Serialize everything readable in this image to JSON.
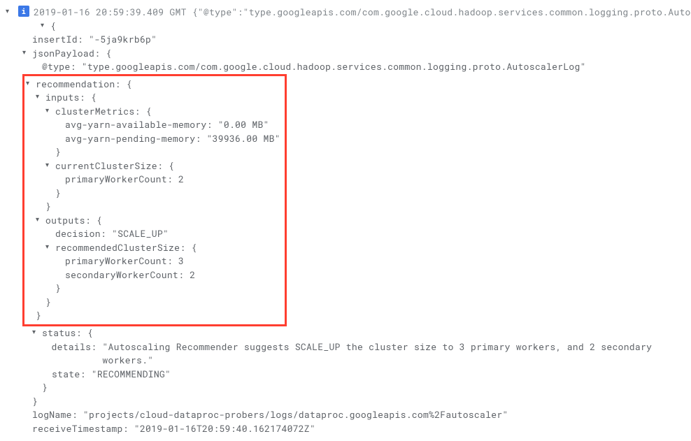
{
  "header": {
    "timestamp": "2019-01-16 20:59:39.409 GMT",
    "summary": "{\"@type\":\"type.googleapis.com/com.google.cloud.hadoop.services.common.logging.proto.AutoscalerLog\""
  },
  "root": {
    "open": "{",
    "insertId": {
      "key": "insertId:",
      "value": "\"-5ja9krb6p\""
    },
    "jsonPayload": {
      "key": "jsonPayload:",
      "open": "{",
      "atType": {
        "key": "@type:",
        "value": "\"type.googleapis.com/com.google.cloud.hadoop.services.common.logging.proto.AutoscalerLog\""
      },
      "recommendation": {
        "key": "recommendation:",
        "open": "{",
        "inputs": {
          "key": "inputs:",
          "open": "{",
          "clusterMetrics": {
            "key": "clusterMetrics:",
            "open": "{",
            "avgAvail": {
              "key": "avg-yarn-available-memory:",
              "value": "\"0.00 MB\""
            },
            "avgPending": {
              "key": "avg-yarn-pending-memory:",
              "value": "\"39936.00 MB\""
            },
            "close": "}"
          },
          "currentClusterSize": {
            "key": "currentClusterSize:",
            "open": "{",
            "primaryWorkerCount": {
              "key": "primaryWorkerCount:",
              "value": "2"
            },
            "close": "}"
          },
          "close": "}"
        },
        "outputs": {
          "key": "outputs:",
          "open": "{",
          "decision": {
            "key": "decision:",
            "value": "\"SCALE_UP\""
          },
          "recommendedClusterSize": {
            "key": "recommendedClusterSize:",
            "open": "{",
            "primaryWorkerCount": {
              "key": "primaryWorkerCount:",
              "value": "3"
            },
            "secondaryWorkerCount": {
              "key": "secondaryWorkerCount:",
              "value": "2"
            },
            "close": "}"
          },
          "close": "}"
        },
        "close": "}"
      },
      "status": {
        "key": "status:",
        "open": "{",
        "details": {
          "key": "details:",
          "value": "\"Autoscaling Recommender suggests SCALE_UP the cluster size to 3 primary workers, and 2 secondary workers.\""
        },
        "state": {
          "key": "state:",
          "value": "\"RECOMMENDING\""
        },
        "close": "}"
      },
      "close": "}"
    },
    "logName": {
      "key": "logName:",
      "value": "\"projects/cloud-dataproc-probers/logs/dataproc.googleapis.com%2Fautoscaler\""
    },
    "receiveTimestamp": {
      "key": "receiveTimestamp:",
      "value": "\"2019-01-16T20:59:40.162174072Z\""
    }
  }
}
